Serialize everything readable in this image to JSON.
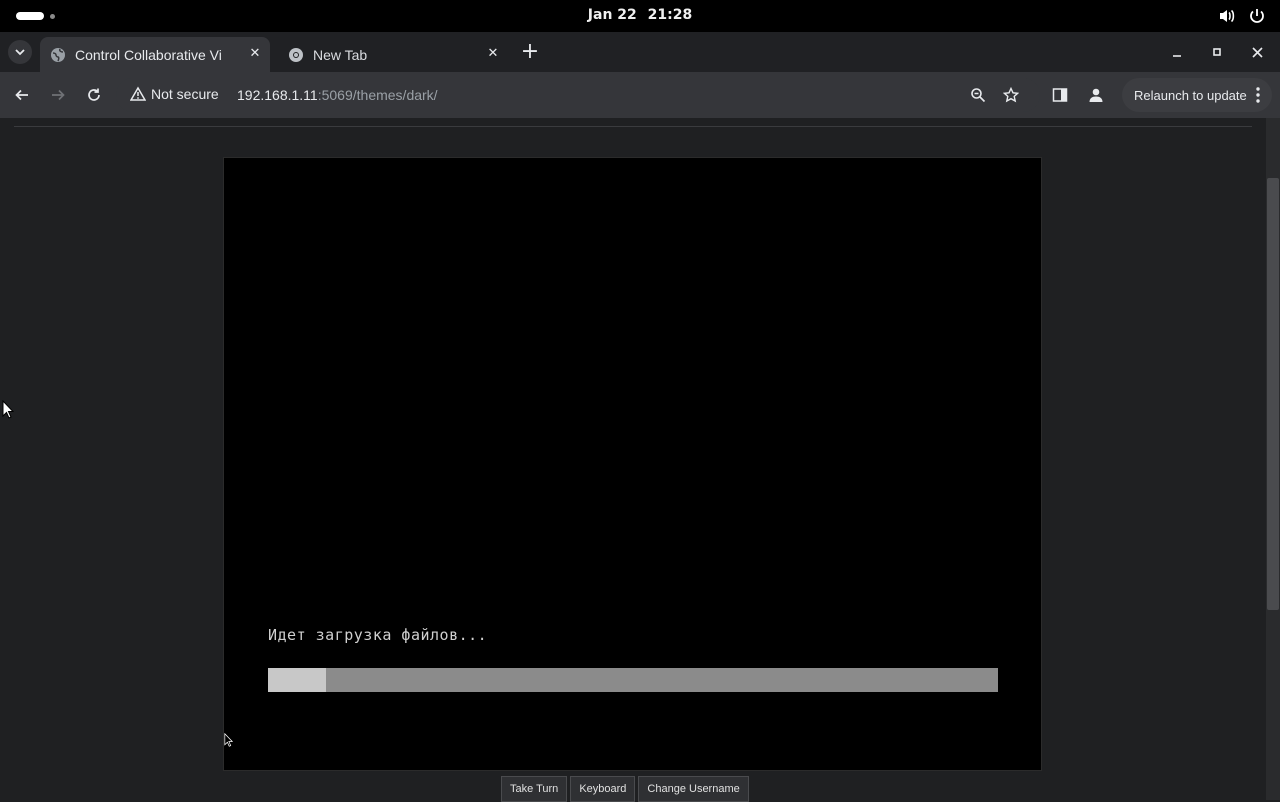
{
  "system_bar": {
    "date": "Jan 22",
    "time": "21:28",
    "icons": [
      "volume-icon",
      "power-icon"
    ]
  },
  "browser": {
    "tabs": [
      {
        "title": "Control Collaborative Vi",
        "active": true,
        "icon": "globe-icon"
      },
      {
        "title": "New Tab",
        "active": false,
        "icon": "chrome-icon"
      }
    ],
    "security_label": "Not secure",
    "url_host": "192.168.1.11",
    "url_path": ":5069/themes/dark/",
    "relaunch_label": "Relaunch to update",
    "colors": {
      "frame": "#202124",
      "toolbar": "#35363a",
      "text": "#e8eaed"
    }
  },
  "vm": {
    "status_text": "Идет загрузка файлов...",
    "progress": 0.08,
    "controls": {
      "take_turn": "Take Turn",
      "keyboard": "Keyboard",
      "change_username": "Change Username"
    }
  }
}
